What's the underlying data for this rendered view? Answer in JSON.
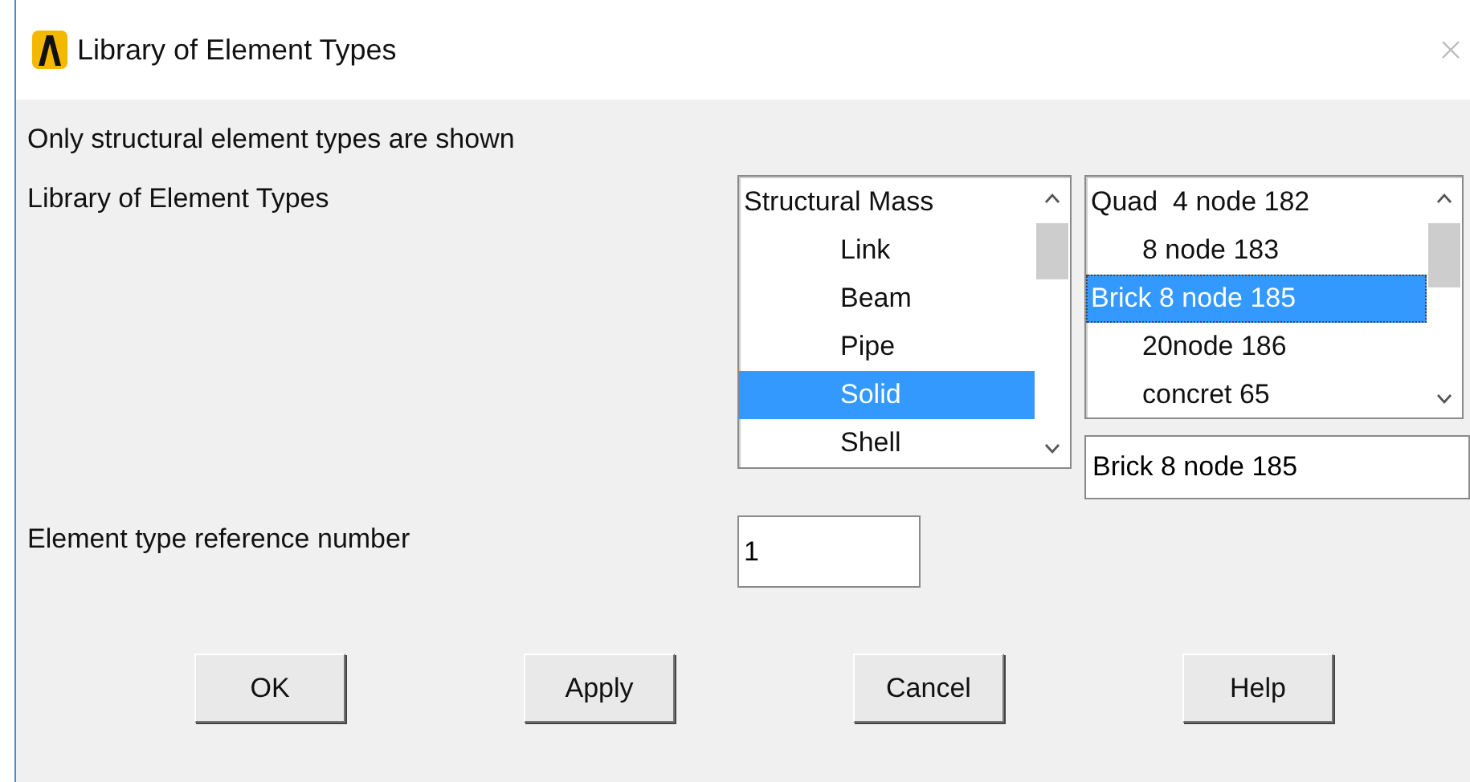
{
  "window": {
    "title": "Library of Element Types"
  },
  "note": "Only structural element types are shown",
  "library_label": "Library of Element Types",
  "category_list": {
    "items": [
      {
        "label": "Structural Mass",
        "selected": false,
        "children": [
          {
            "label": "Link",
            "selected": false
          },
          {
            "label": "Beam",
            "selected": false
          },
          {
            "label": "Pipe",
            "selected": false
          },
          {
            "label": "Solid",
            "selected": true
          },
          {
            "label": "Shell",
            "selected": false
          }
        ]
      }
    ]
  },
  "type_list": {
    "items": [
      {
        "label": "Quad  4 node 182",
        "selected": false,
        "children": [
          {
            "label": "8 node 183",
            "selected": false
          }
        ]
      },
      {
        "label": "Brick 8 node 185",
        "selected": true,
        "children": [
          {
            "label": "20node 186",
            "selected": false
          },
          {
            "label": "concret 65",
            "selected": false
          }
        ]
      }
    ]
  },
  "selected_type_field": {
    "value": "Brick 8 node 185"
  },
  "reference_number": {
    "label": "Element type reference number",
    "value": "1"
  },
  "buttons": [
    "OK",
    "Apply",
    "Cancel",
    "Help"
  ]
}
